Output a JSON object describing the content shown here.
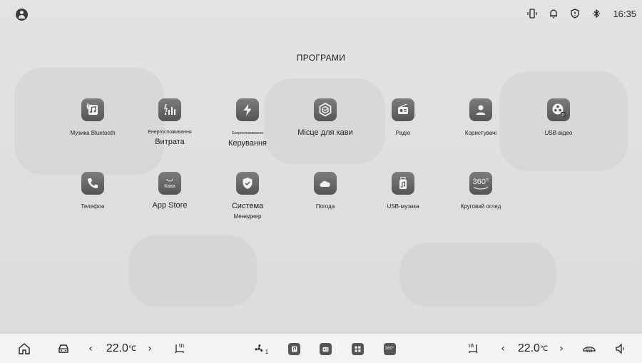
{
  "status_bar": {
    "time": "16:35",
    "icons": [
      "phone-signal-icon",
      "bell-icon",
      "shield-icon",
      "bluetooth-icon"
    ]
  },
  "section_title": "ПРОГРАМИ",
  "apps_row1": [
    {
      "icon": "bluetooth-music-icon",
      "label": "Музика Bluetooth",
      "sub": ""
    },
    {
      "icon": "energy-consumption-icon",
      "label": "Енергоспоживання",
      "sub": "Витрата"
    },
    {
      "icon": "energy-control-icon",
      "label": "Енергоспоживання",
      "sub": "Керування"
    },
    {
      "icon": "coffee-place-icon",
      "label": "Місце для кави",
      "sub": ""
    },
    {
      "icon": "radio-icon",
      "label": "Радіо",
      "sub": ""
    },
    {
      "icon": "user-icon",
      "label": "Користувачі",
      "sub": ""
    },
    {
      "icon": "usb-video-icon",
      "label": "USB-відео",
      "sub": ""
    }
  ],
  "apps_row2": [
    {
      "icon": "phone-icon",
      "label": "Телефон",
      "sub": ""
    },
    {
      "icon": "app-store-icon",
      "label": "App Store",
      "sub": "",
      "icon_text": "Кава"
    },
    {
      "icon": "system-manager-icon",
      "label": "Система",
      "sub": "Менеджер"
    },
    {
      "icon": "weather-icon",
      "label": "Погода",
      "sub": ""
    },
    {
      "icon": "usb-music-icon",
      "label": "USB-музика",
      "sub": ""
    },
    {
      "icon": "surround-view-icon",
      "label": "Круговий огляд",
      "sub": "",
      "icon_text": "360°"
    }
  ],
  "bottom_bar": {
    "left_temp": "22.0",
    "right_temp": "22.0",
    "temp_unit": "℃",
    "fan_level": "1",
    "dock_360": "360°"
  }
}
